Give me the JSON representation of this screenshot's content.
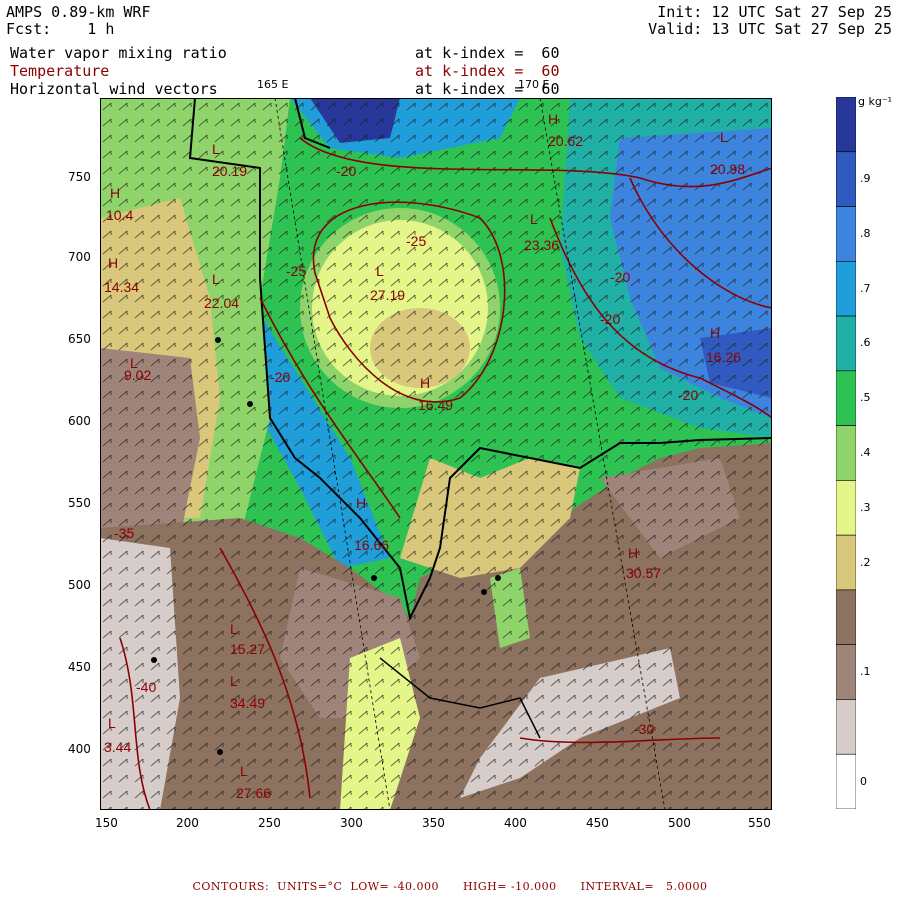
{
  "header": {
    "model": "AMPS 0.89-km WRF",
    "fcst_label": "Fcst:",
    "fcst_value": "1 h",
    "init": "Init: 12 UTC Sat 27 Sep 25",
    "valid": "Valid: 13 UTC Sat 27 Sep 25"
  },
  "fields": [
    {
      "name": "Water vapor mixing ratio",
      "level": "at k-index =  60",
      "color": "#000000"
    },
    {
      "name": "Temperature",
      "level": "at k-index =  60",
      "color": "#8b0000"
    },
    {
      "name": "Horizontal wind vectors",
      "level": "at k-index =  60",
      "color": "#000000"
    }
  ],
  "lon_labels": [
    "165 E",
    "170 E"
  ],
  "x_ticks": [
    "150",
    "200",
    "250",
    "300",
    "350",
    "400",
    "450",
    "500",
    "550"
  ],
  "y_ticks": [
    "400",
    "450",
    "500",
    "550",
    "600",
    "650",
    "700",
    "750"
  ],
  "colorbar": {
    "unit": "g kg⁻¹",
    "levels": [
      {
        "label": "",
        "color": "#27389a"
      },
      {
        "label": ".9",
        "color": "#2f5bc0"
      },
      {
        "label": ".8",
        "color": "#3d84de"
      },
      {
        "label": ".7",
        "color": "#1f9ed9"
      },
      {
        "label": ".6",
        "color": "#20b0a6"
      },
      {
        "label": ".5",
        "color": "#2ec253"
      },
      {
        "label": ".4",
        "color": "#8fd46b"
      },
      {
        "label": ".3",
        "color": "#e4f58a"
      },
      {
        "label": ".2",
        "color": "#d9c77c"
      },
      {
        "label": "",
        "color": "#8d7260"
      },
      {
        "label": ".1",
        "color": "#9e8479"
      },
      {
        "label": "",
        "color": "#d6cdcb"
      },
      {
        "label": "0",
        "color": "#ffffff"
      }
    ]
  },
  "annotations": [
    {
      "type": "H",
      "value": "20.62"
    },
    {
      "type": "L",
      "value": "20.98"
    },
    {
      "type": "L",
      "value": "20.19"
    },
    {
      "type": "H",
      "value": "10.4"
    },
    {
      "type": "L",
      "value": "23.36"
    },
    {
      "type": "L",
      "value": "27.19"
    },
    {
      "type": "H",
      "value": "14.34"
    },
    {
      "type": "L",
      "value": "22.04"
    },
    {
      "type": "H",
      "value": "16.26"
    },
    {
      "type": "H",
      "value": "16.49"
    },
    {
      "type": "L",
      "value": "9.02"
    },
    {
      "type": "H",
      "value": "16.66"
    },
    {
      "type": "H",
      "value": "30.57"
    },
    {
      "type": "L",
      "value": "15.27"
    },
    {
      "type": "L",
      "value": "34.49"
    },
    {
      "type": "L",
      "value": "3.44"
    },
    {
      "type": "L",
      "value": "27.66"
    }
  ],
  "contour_labels": [
    "-20",
    "-25",
    "-25",
    "-20",
    "-20",
    "-20",
    "-20",
    "-40",
    "-30",
    "-35"
  ],
  "footer": {
    "text": "CONTOURS:  UNITS=°C  LOW= -40.000      HIGH= -10.000      INTERVAL=   5.0000"
  }
}
